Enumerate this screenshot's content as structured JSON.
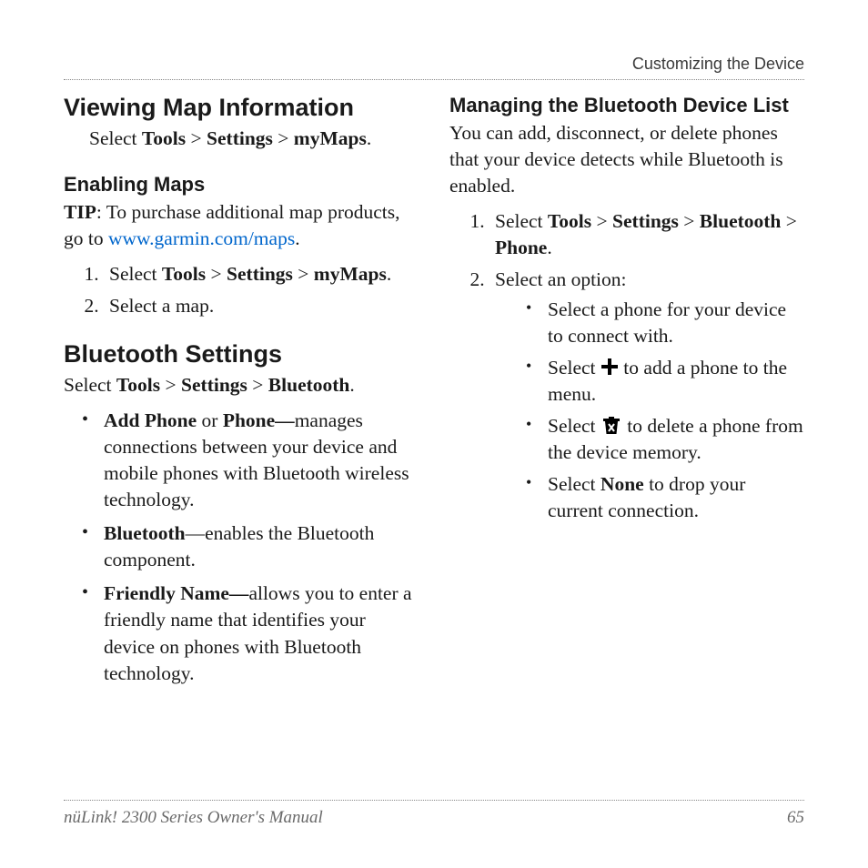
{
  "running_head": "Customizing the Device",
  "left": {
    "h1": "Viewing Map Information",
    "path_pre": "Select ",
    "path_parts": [
      "Tools",
      "Settings",
      "myMaps"
    ],
    "gt": " > ",
    "period": ".",
    "enabling": {
      "heading": "Enabling Maps",
      "tip_label": "TIP",
      "tip_text": ": To purchase additional map products, go to ",
      "link_text": "www.garmin.com/maps",
      "steps": {
        "s1_pre": "Select ",
        "s1_parts": [
          "Tools",
          "Settings",
          "myMaps"
        ],
        "s2": "Select a map."
      }
    },
    "bt": {
      "heading": "Bluetooth Settings",
      "path_pre": "Select ",
      "path_parts": [
        "Tools",
        "Settings",
        "Bluetooth"
      ],
      "items": {
        "addphone_bold1": "Add Phone",
        "addphone_or": " or ",
        "addphone_bold2": "Phone—",
        "addphone_rest": "manages connections between your device and mobile phones with Bluetooth wireless technology.",
        "bluetooth_bold": "Bluetooth",
        "bluetooth_rest": "—enables the Bluetooth component.",
        "friendly_bold": "Friendly Name—",
        "friendly_rest": "allows you to enter a friendly name that identifies your device on phones with Bluetooth technology."
      }
    }
  },
  "right": {
    "h2": "Managing the Bluetooth Device List",
    "intro": "You can add, disconnect, or delete phones that your device detects while Bluetooth is enabled.",
    "steps": {
      "s1_pre": "Select ",
      "s1_parts": [
        "Tools",
        "Settings",
        "Bluetooth",
        "Phone"
      ],
      "s2": "Select an option:",
      "opts": {
        "o1": "Select a phone for your device to connect with.",
        "o2_pre": "Select ",
        "o2_post": " to add a phone to the menu.",
        "o3_pre": "Select ",
        "o3_post": " to delete a phone from the device memory.",
        "o4_pre": "Select ",
        "o4_bold": "None",
        "o4_post": " to drop your current connection."
      }
    }
  },
  "footer": {
    "title": "nüLink! 2300 Series Owner's Manual",
    "page": "65"
  }
}
